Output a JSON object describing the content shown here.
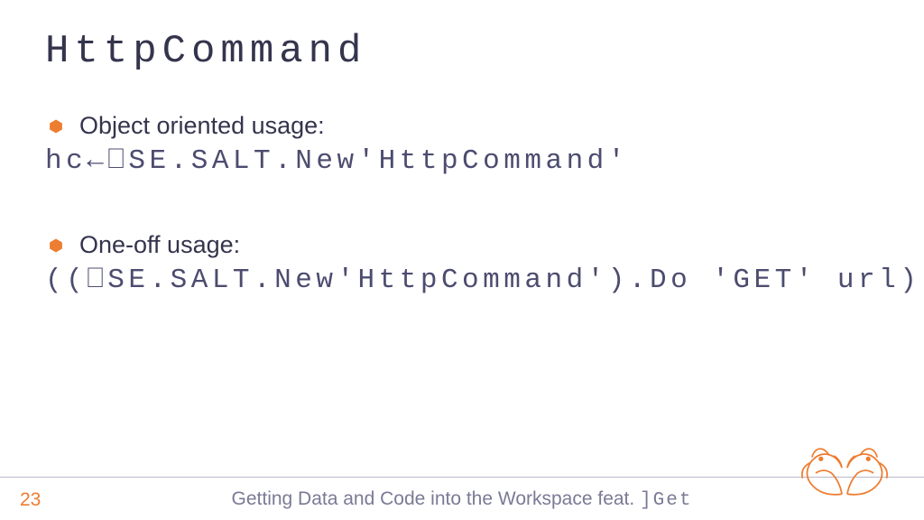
{
  "title": "HttpCommand",
  "bullets": [
    {
      "label": "Object oriented usage:",
      "code": "hc←⎕SE.SALT.New'HttpCommand'"
    },
    {
      "label": "One-off usage:",
      "code": "((⎕SE.SALT.New'HttpCommand').Do 'GET' url).Data"
    }
  ],
  "footer": {
    "page": "23",
    "text_prefix": "Getting Data and Code into the Workspace feat. ",
    "text_mono": "]Get"
  },
  "colors": {
    "accent": "#ed7d31",
    "text": "#34344d"
  }
}
